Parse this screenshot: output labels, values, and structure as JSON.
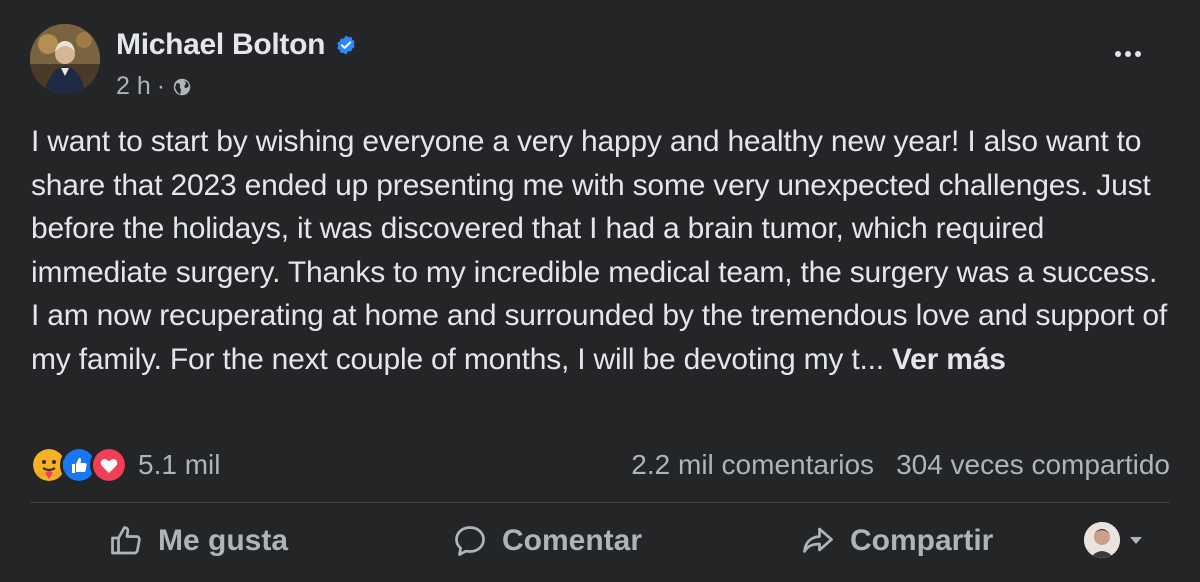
{
  "post": {
    "author": "Michael Bolton",
    "time": "2 h",
    "separator": "·",
    "text": "I want to start by wishing everyone a very happy and healthy new year! I also want to share that 2023 ended up presenting me with some very unexpected challenges. Just before the holidays, it was discovered that I had a brain tumor, which required immediate surgery. Thanks to my incredible medical team, the surgery was a success. I am now recuperating at home and surrounded by the tremendous love and support of my family. For the next couple of months, I will be devoting my t...",
    "see_more": "Ver más"
  },
  "stats": {
    "reactions_count": "5.1 mil",
    "comments": "2.2 mil comentarios",
    "shares": "304 veces compartido",
    "reaction_icons": [
      "care-icon",
      "like-icon",
      "love-icon"
    ]
  },
  "actions": {
    "like": "Me gusta",
    "comment": "Comentar",
    "share": "Compartir"
  },
  "colors": {
    "background": "#242526",
    "text_primary": "#e4e6eb",
    "text_secondary": "#b0b3b8",
    "verified": "#2d88ff",
    "like": "#1877f2",
    "love": "#f33e58",
    "care": "#f7b125"
  },
  "icons": {
    "verified": "verified-badge-icon",
    "audience": "globe-icon",
    "more": "more-options-icon",
    "like": "thumbs-up-icon",
    "comment": "comment-bubble-icon",
    "share": "share-arrow-icon"
  }
}
